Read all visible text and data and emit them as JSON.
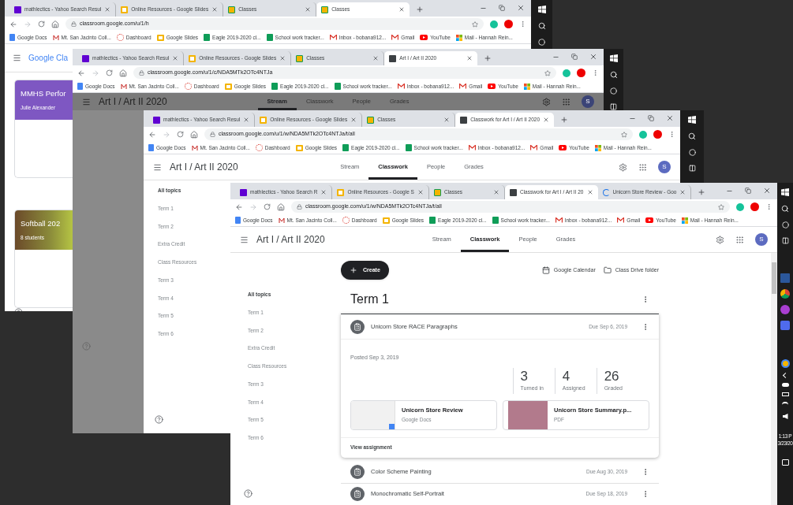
{
  "windows": [
    {
      "tabs": [
        {
          "title": "mathlectics - Yahoo Search Resul",
          "kind": "yahoo",
          "selected": false
        },
        {
          "title": "Online Resources - Google Slides",
          "kind": "slides",
          "selected": false
        },
        {
          "title": "Classes",
          "kind": "classroom",
          "selected": false
        },
        {
          "title": "Classes",
          "kind": "classroom",
          "selected": true
        }
      ],
      "url": "classroom.google.com/u/1/h",
      "bookmarks": [
        {
          "label": "Google Docs",
          "kind": "docs"
        },
        {
          "label": "Mt. San Jacinto Coll...",
          "kind": "college"
        },
        {
          "label": "Dashboard",
          "kind": "dashboard"
        },
        {
          "label": "Google Slides",
          "kind": "slides"
        },
        {
          "label": "Eagle 2019-2020 cl...",
          "kind": "sheets"
        },
        {
          "label": "School work tracker...",
          "kind": "sheets"
        },
        {
          "label": "Inbox - bobana912...",
          "kind": "gmail"
        },
        {
          "label": "Gmail",
          "kind": "gmail"
        },
        {
          "label": "YouTube",
          "kind": "youtube"
        },
        {
          "label": "Mail - Hannah Rein...",
          "kind": "microsoft"
        }
      ],
      "page": {
        "kind": "home",
        "brand": "Google Cla",
        "cards": [
          {
            "kind": "color",
            "title": "MMHS Perfor",
            "subtitle": "Julie Alexander"
          },
          {
            "kind": "photo",
            "title": "Softball 202",
            "subtitle": "8 students"
          }
        ]
      }
    },
    {
      "tabs": [
        {
          "title": "mathlectics - Yahoo Search Resul",
          "kind": "yahoo",
          "selected": false
        },
        {
          "title": "Online Resources - Google Slides",
          "kind": "slides",
          "selected": false
        },
        {
          "title": "Classes",
          "kind": "classroom",
          "selected": false
        },
        {
          "title": "Art I / Art II 2020",
          "kind": "classwork",
          "selected": true
        }
      ],
      "url": "classroom.google.com/u/1/c/NDA5MTk2OTc4NTJa",
      "bookmarks": [
        {
          "label": "Google Docs",
          "kind": "docs"
        },
        {
          "label": "Mt. San Jacinto Coll...",
          "kind": "college"
        },
        {
          "label": "Dashboard",
          "kind": "dashboard"
        },
        {
          "label": "Google Slides",
          "kind": "slides"
        },
        {
          "label": "Eagle 2019-2020 cl...",
          "kind": "sheets"
        },
        {
          "label": "School work tracker...",
          "kind": "sheets"
        },
        {
          "label": "Inbox - bobana912...",
          "kind": "gmail"
        },
        {
          "label": "Gmail",
          "kind": "gmail"
        },
        {
          "label": "YouTube",
          "kind": "youtube"
        },
        {
          "label": "Mail - Hannah Rein...",
          "kind": "microsoft"
        }
      ],
      "page": {
        "kind": "class",
        "dimmed": true,
        "title": "Art I / Art II 2020",
        "avatar": "S",
        "nav": [
          {
            "label": "Stream",
            "selected": true
          },
          {
            "label": "Classwork",
            "selected": false
          },
          {
            "label": "People",
            "selected": false
          },
          {
            "label": "Grades",
            "selected": false
          }
        ],
        "body": {
          "kind": "overlay"
        }
      }
    },
    {
      "tabs": [
        {
          "title": "mathlectics - Yahoo Search Resul",
          "kind": "yahoo",
          "selected": false
        },
        {
          "title": "Online Resources - Google Slides",
          "kind": "slides",
          "selected": false
        },
        {
          "title": "Classes",
          "kind": "classroom",
          "selected": false
        },
        {
          "title": "Classwork for Art I / Art II 2020",
          "kind": "classwork",
          "selected": true
        }
      ],
      "url": "classroom.google.com/u/1/w/NDA5MTk2OTc4NTJa/t/all",
      "bookmarks": [
        {
          "label": "Google Docs",
          "kind": "docs"
        },
        {
          "label": "Mt. San Jacinto Coll...",
          "kind": "college"
        },
        {
          "label": "Dashboard",
          "kind": "dashboard"
        },
        {
          "label": "Google Slides",
          "kind": "slides"
        },
        {
          "label": "Eagle 2019-2020 cl...",
          "kind": "sheets"
        },
        {
          "label": "School work tracker...",
          "kind": "sheets"
        },
        {
          "label": "Inbox - bobana912...",
          "kind": "gmail"
        },
        {
          "label": "Gmail",
          "kind": "gmail"
        },
        {
          "label": "YouTube",
          "kind": "youtube"
        },
        {
          "label": "Mail - Hannah Rein...",
          "kind": "microsoft"
        }
      ],
      "page": {
        "kind": "class",
        "dimmed": false,
        "title": "Art I / Art II 2020",
        "avatar": "S",
        "nav": [
          {
            "label": "Stream",
            "selected": false
          },
          {
            "label": "Classwork",
            "selected": true
          },
          {
            "label": "People",
            "selected": false
          },
          {
            "label": "Grades",
            "selected": false
          }
        ],
        "body": {
          "kind": "topics",
          "topics": [
            {
              "label": "All topics",
              "selected": true
            },
            {
              "label": "Term 1",
              "selected": false
            },
            {
              "label": "Term 2",
              "selected": false
            },
            {
              "label": "Extra Credit",
              "selected": false
            },
            {
              "label": "Class Resources",
              "selected": false
            },
            {
              "label": "Term 3",
              "selected": false
            },
            {
              "label": "Term 4",
              "selected": false
            },
            {
              "label": "Term 5",
              "selected": false
            },
            {
              "label": "Term 6",
              "selected": false
            }
          ]
        }
      }
    },
    {
      "tabs": [
        {
          "title": "mathlectics - Yahoo Search R",
          "kind": "yahoo",
          "selected": false
        },
        {
          "title": "Online Resources - Google S",
          "kind": "slides",
          "selected": false
        },
        {
          "title": "Classes",
          "kind": "classroom",
          "selected": false
        },
        {
          "title": "Classwork for Art I / Art II 20",
          "kind": "classwork",
          "selected": true
        },
        {
          "title": "Unicorn Store Review - Goo",
          "kind": "loading",
          "selected": false
        }
      ],
      "url": "classroom.google.com/u/1/w/NDA5MTk2OTc4NTJa/t/all",
      "bookmarks": [
        {
          "label": "Google Docs",
          "kind": "docs"
        },
        {
          "label": "Mt. San Jacinto Coll...",
          "kind": "college"
        },
        {
          "label": "Dashboard",
          "kind": "dashboard"
        },
        {
          "label": "Google Slides",
          "kind": "slides"
        },
        {
          "label": "Eagle 2019-2020 cl...",
          "kind": "sheets"
        },
        {
          "label": "School work tracker...",
          "kind": "sheets"
        },
        {
          "label": "Inbox - bobana912...",
          "kind": "gmail"
        },
        {
          "label": "Gmail",
          "kind": "gmail"
        },
        {
          "label": "YouTube",
          "kind": "youtube"
        },
        {
          "label": "Mail - Hannah Rein...",
          "kind": "microsoft"
        }
      ],
      "page": {
        "kind": "class",
        "dimmed": false,
        "title": "Art I / Art II 2020",
        "avatar": "S",
        "nav": [
          {
            "label": "Stream",
            "selected": false
          },
          {
            "label": "Classwork",
            "selected": true
          },
          {
            "label": "People",
            "selected": false
          },
          {
            "label": "Grades",
            "selected": false
          }
        ],
        "body": {
          "kind": "classwork",
          "create": "Create",
          "links": [
            {
              "label": "Google Calendar",
              "kind": "calendar"
            },
            {
              "label": "Class Drive folder",
              "kind": "folder"
            }
          ],
          "topics": [
            {
              "label": "All topics",
              "selected": true
            },
            {
              "label": "Term 1",
              "selected": false
            },
            {
              "label": "Term 2",
              "selected": false
            },
            {
              "label": "Extra Credit",
              "selected": false
            },
            {
              "label": "Class Resources",
              "selected": false
            },
            {
              "label": "Term 3",
              "selected": false
            },
            {
              "label": "Term 4",
              "selected": false
            },
            {
              "label": "Term 5",
              "selected": false
            },
            {
              "label": "Term 6",
              "selected": false
            }
          ],
          "section": "Term 1",
          "expanded": {
            "title": "Unicorn Store RACE Paragraphs",
            "due": "Due Sep 6, 2019",
            "posted": "Posted Sep 3, 2019",
            "stats": [
              {
                "value": "3",
                "label": "Turned in"
              },
              {
                "value": "4",
                "label": "Assigned"
              },
              {
                "value": "26",
                "label": "Graded"
              }
            ],
            "attachments": [
              {
                "kind": "doc",
                "title": "Unicorn Store Review",
                "type": "Google Docs"
              },
              {
                "kind": "photo",
                "title": "Unicorn Store Summary.p...",
                "type": "PDF"
              }
            ],
            "action": "View assignment"
          },
          "items": [
            {
              "title": "Color Scheme Painting",
              "due": "Due Aug 30, 2019"
            },
            {
              "title": "Monochromatic Self-Portrait",
              "due": "Due Sep 18, 2019"
            }
          ]
        }
      },
      "taskbar": {
        "clock": [
          "1:13 P",
          "3/23/20"
        ]
      }
    }
  ]
}
